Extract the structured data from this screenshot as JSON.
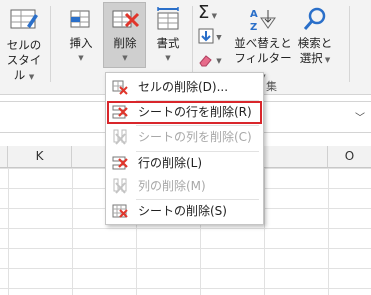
{
  "ribbon": {
    "style_button": {
      "line1": "セルの",
      "line2": "スタイル"
    },
    "insert_button": {
      "label": "挿入"
    },
    "delete_button": {
      "label": "削除"
    },
    "format_button": {
      "label": "書式"
    },
    "sort_filter_button": {
      "line1": "並べ替えと",
      "line2": "フィルター"
    },
    "find_select_button": {
      "line1": "検索と",
      "line2": "選択"
    },
    "editing_group_label_fragment": "集"
  },
  "formula_bar": {
    "value": ""
  },
  "columns": [
    "K",
    "O"
  ],
  "delete_menu": {
    "items": [
      {
        "label": "セルの削除(D)...",
        "enabled": true,
        "icon": "delete-cells-icon"
      },
      {
        "label": "シートの行を削除(R)",
        "enabled": true,
        "highlighted": true,
        "icon": "delete-sheet-rows-icon"
      },
      {
        "label": "シートの列を削除(C)",
        "enabled": false,
        "icon": "delete-sheet-columns-icon"
      },
      {
        "label": "行の削除(L)",
        "enabled": true,
        "icon": "delete-rows-icon"
      },
      {
        "label": "列の削除(M)",
        "enabled": false,
        "icon": "delete-columns-icon"
      },
      {
        "label": "シートの削除(S)",
        "enabled": true,
        "icon": "delete-sheet-icon"
      }
    ]
  },
  "colors": {
    "highlight_border": "#d9262b",
    "delete_x": "#e0352b",
    "accent_blue": "#2a6fc9"
  }
}
